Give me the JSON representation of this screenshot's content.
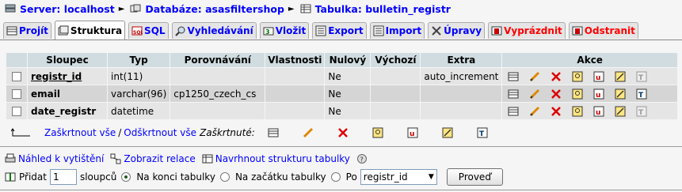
{
  "breadcrumb": {
    "server_label": "Server: localhost",
    "database_label": "Databáze: asasfiltershop",
    "table_label": "Tabulka: bulletin_registr",
    "separator": "►"
  },
  "tabs": [
    {
      "label": "Projít",
      "icon": "browse-icon"
    },
    {
      "label": "Struktura",
      "icon": "structure-icon"
    },
    {
      "label": "SQL",
      "icon": "sql-icon"
    },
    {
      "label": "Vyhledávání",
      "icon": "search-icon"
    },
    {
      "label": "Vložit",
      "icon": "insert-icon"
    },
    {
      "label": "Export",
      "icon": "export-icon"
    },
    {
      "label": "Import",
      "icon": "import-icon"
    },
    {
      "label": "Úpravy",
      "icon": "operations-icon"
    },
    {
      "label": "Vyprázdnit",
      "icon": "empty-icon"
    },
    {
      "label": "Odstranit",
      "icon": "drop-icon"
    }
  ],
  "table": {
    "headers": [
      "Sloupec",
      "Typ",
      "Porovnávání",
      "Vlastnosti",
      "Nulový",
      "Výchozí",
      "Extra",
      "Akce"
    ],
    "rows": [
      {
        "column": "registr_id",
        "type": "int(11)",
        "collation": "",
        "attributes": "",
        "null": "Ne",
        "default": "",
        "extra": "auto_increment"
      },
      {
        "column": "email",
        "type": "varchar(96)",
        "collation": "cp1250_czech_cs",
        "attributes": "",
        "null": "Ne",
        "default": "",
        "extra": ""
      },
      {
        "column": "date_registr",
        "type": "datetime",
        "collation": "",
        "attributes": "",
        "null": "Ne",
        "default": "",
        "extra": ""
      }
    ]
  },
  "with_selected": {
    "check_all": "Zaškrtnout vše",
    "slash": "/",
    "uncheck_all": "Odškrtnout vše",
    "label": "Zaškrtnuté:"
  },
  "links": {
    "print_view": "Náhled k vytištění",
    "relation_view": "Zobrazit relace",
    "propose_structure": "Navrhnout strukturu tabulky"
  },
  "add_column": {
    "label": "Přidat",
    "count": "1",
    "columns_label": "sloupců",
    "at_end": "Na konci tabulky",
    "at_start": "Na začátku tabulky",
    "after": "Po",
    "after_select": "registr_id",
    "button": "Proveď"
  },
  "colors": {
    "header_bg": "#D0DCE0",
    "row_odd": "#E5E5E5",
    "row_even": "#D5D5D5",
    "link": "#0000FF",
    "danger": "#FF0000"
  }
}
